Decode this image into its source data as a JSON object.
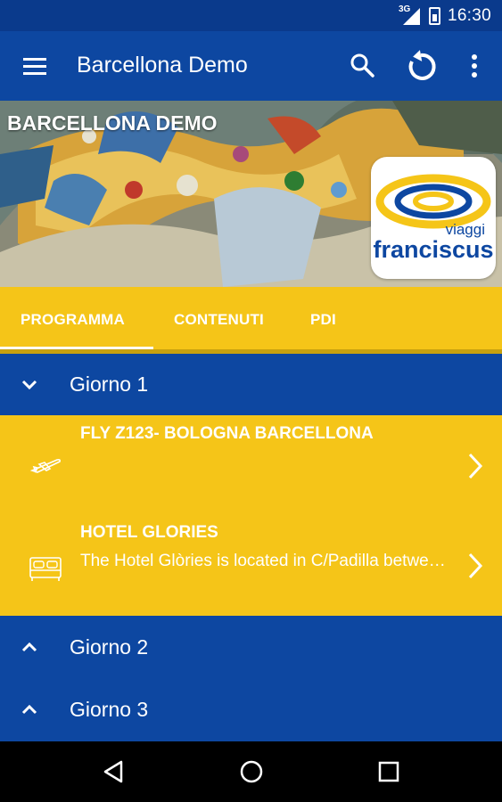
{
  "status_bar": {
    "network": "3G",
    "time": "16:30"
  },
  "app_bar": {
    "title": "Barcellona Demo",
    "icons": [
      "menu-icon",
      "search-icon",
      "refresh-icon",
      "more-vert-icon"
    ]
  },
  "hero": {
    "title": "BARCELLONA DEMO",
    "logo_text": [
      "viaggi",
      "franciscus"
    ]
  },
  "tabs": [
    {
      "label": "PROGRAMMA",
      "selected": true
    },
    {
      "label": "CONTENUTI",
      "selected": false
    },
    {
      "label": "PDI",
      "selected": false
    }
  ],
  "days": [
    {
      "label": "Giorno 1",
      "expanded": true,
      "icon": "chevron-down-icon"
    },
    {
      "label": "Giorno 2",
      "expanded": false,
      "icon": "chevron-up-icon"
    },
    {
      "label": "Giorno 3",
      "expanded": false,
      "icon": "chevron-up-icon"
    }
  ],
  "events": [
    {
      "icon": "airplane-icon",
      "title": "FLY Z123-  BOLOGNA BARCELLONA",
      "description": ""
    },
    {
      "icon": "bed-icon",
      "title": "HOTEL GLORIES",
      "description": "The Hotel Glòries is located in C/Padilla between Diagonal and Gran Via"
    }
  ],
  "nav_bar": {
    "icons": [
      "back-icon",
      "home-icon",
      "recents-icon"
    ]
  },
  "colors": {
    "primary_blue": "#0d47a1",
    "accent_yellow": "#f5c518",
    "white": "#ffffff"
  }
}
